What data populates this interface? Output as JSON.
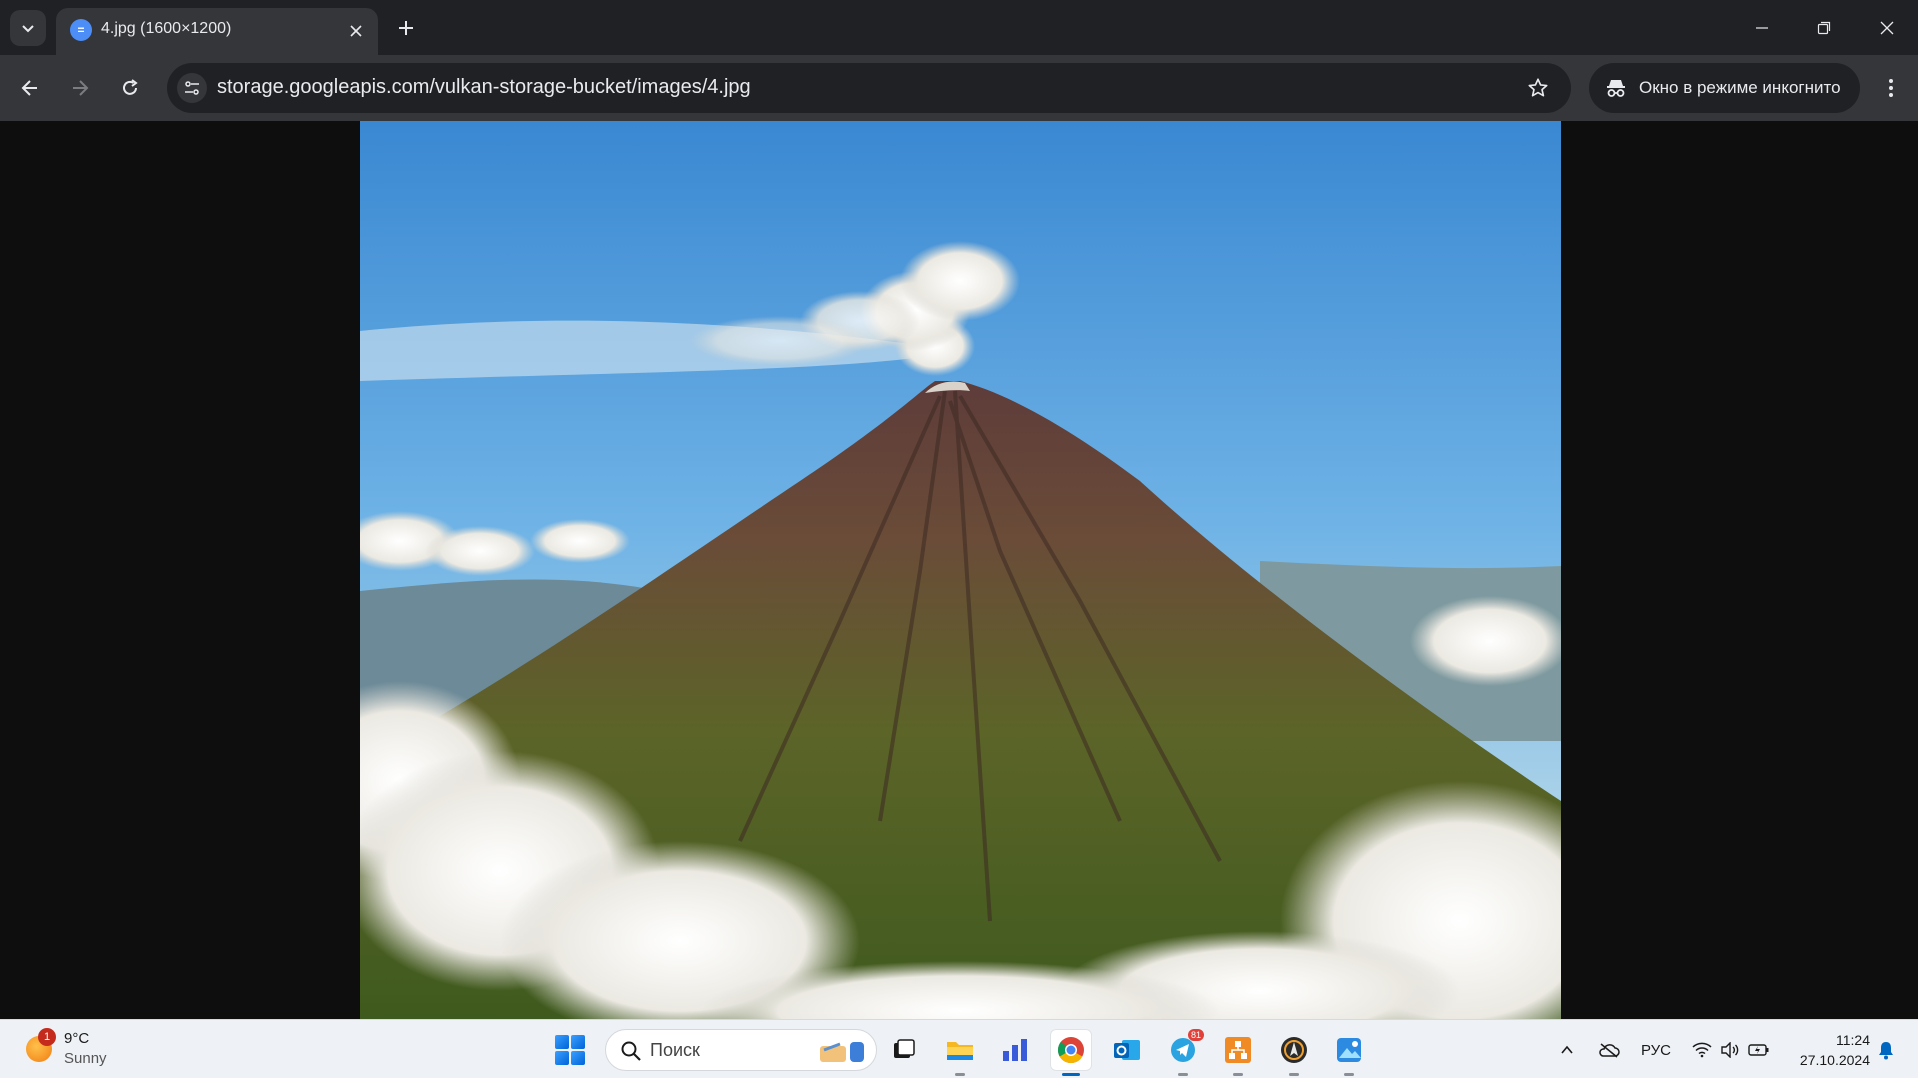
{
  "browser": {
    "tab": {
      "title": "4.jpg (1600×1200)"
    },
    "address_bar": {
      "url": "storage.googleapis.com/vulkan-storage-bucket/images/4.jpg"
    },
    "incognito_label": "Окно в режиме инкогнито"
  },
  "image": {
    "subject": "Volcano with smoke plume above clouds",
    "colors": {
      "sky_top": "#3f8fd6",
      "sky_bottom": "#a9cde6",
      "slope": "#5f6a2a",
      "ridge": "#6e4a3e",
      "cloud": "#f4f2ec"
    }
  },
  "taskbar": {
    "weather": {
      "badge": "1",
      "temp": "9°C",
      "condition": "Sunny"
    },
    "search_label": "Поиск",
    "apps": [
      {
        "name": "task-view"
      },
      {
        "name": "file-explorer"
      },
      {
        "name": "analytics-app"
      },
      {
        "name": "chrome",
        "active": true
      },
      {
        "name": "outlook"
      },
      {
        "name": "telegram",
        "badge": "81"
      },
      {
        "name": "orange-app"
      },
      {
        "name": "dark-app"
      },
      {
        "name": "photos-app"
      }
    ],
    "language": "РУС",
    "time": "11:24",
    "date": "27.10.2024"
  },
  "theme": {
    "accent": "#0067c0",
    "chrome_dark": "#202124",
    "chrome_mid": "#35363a"
  }
}
